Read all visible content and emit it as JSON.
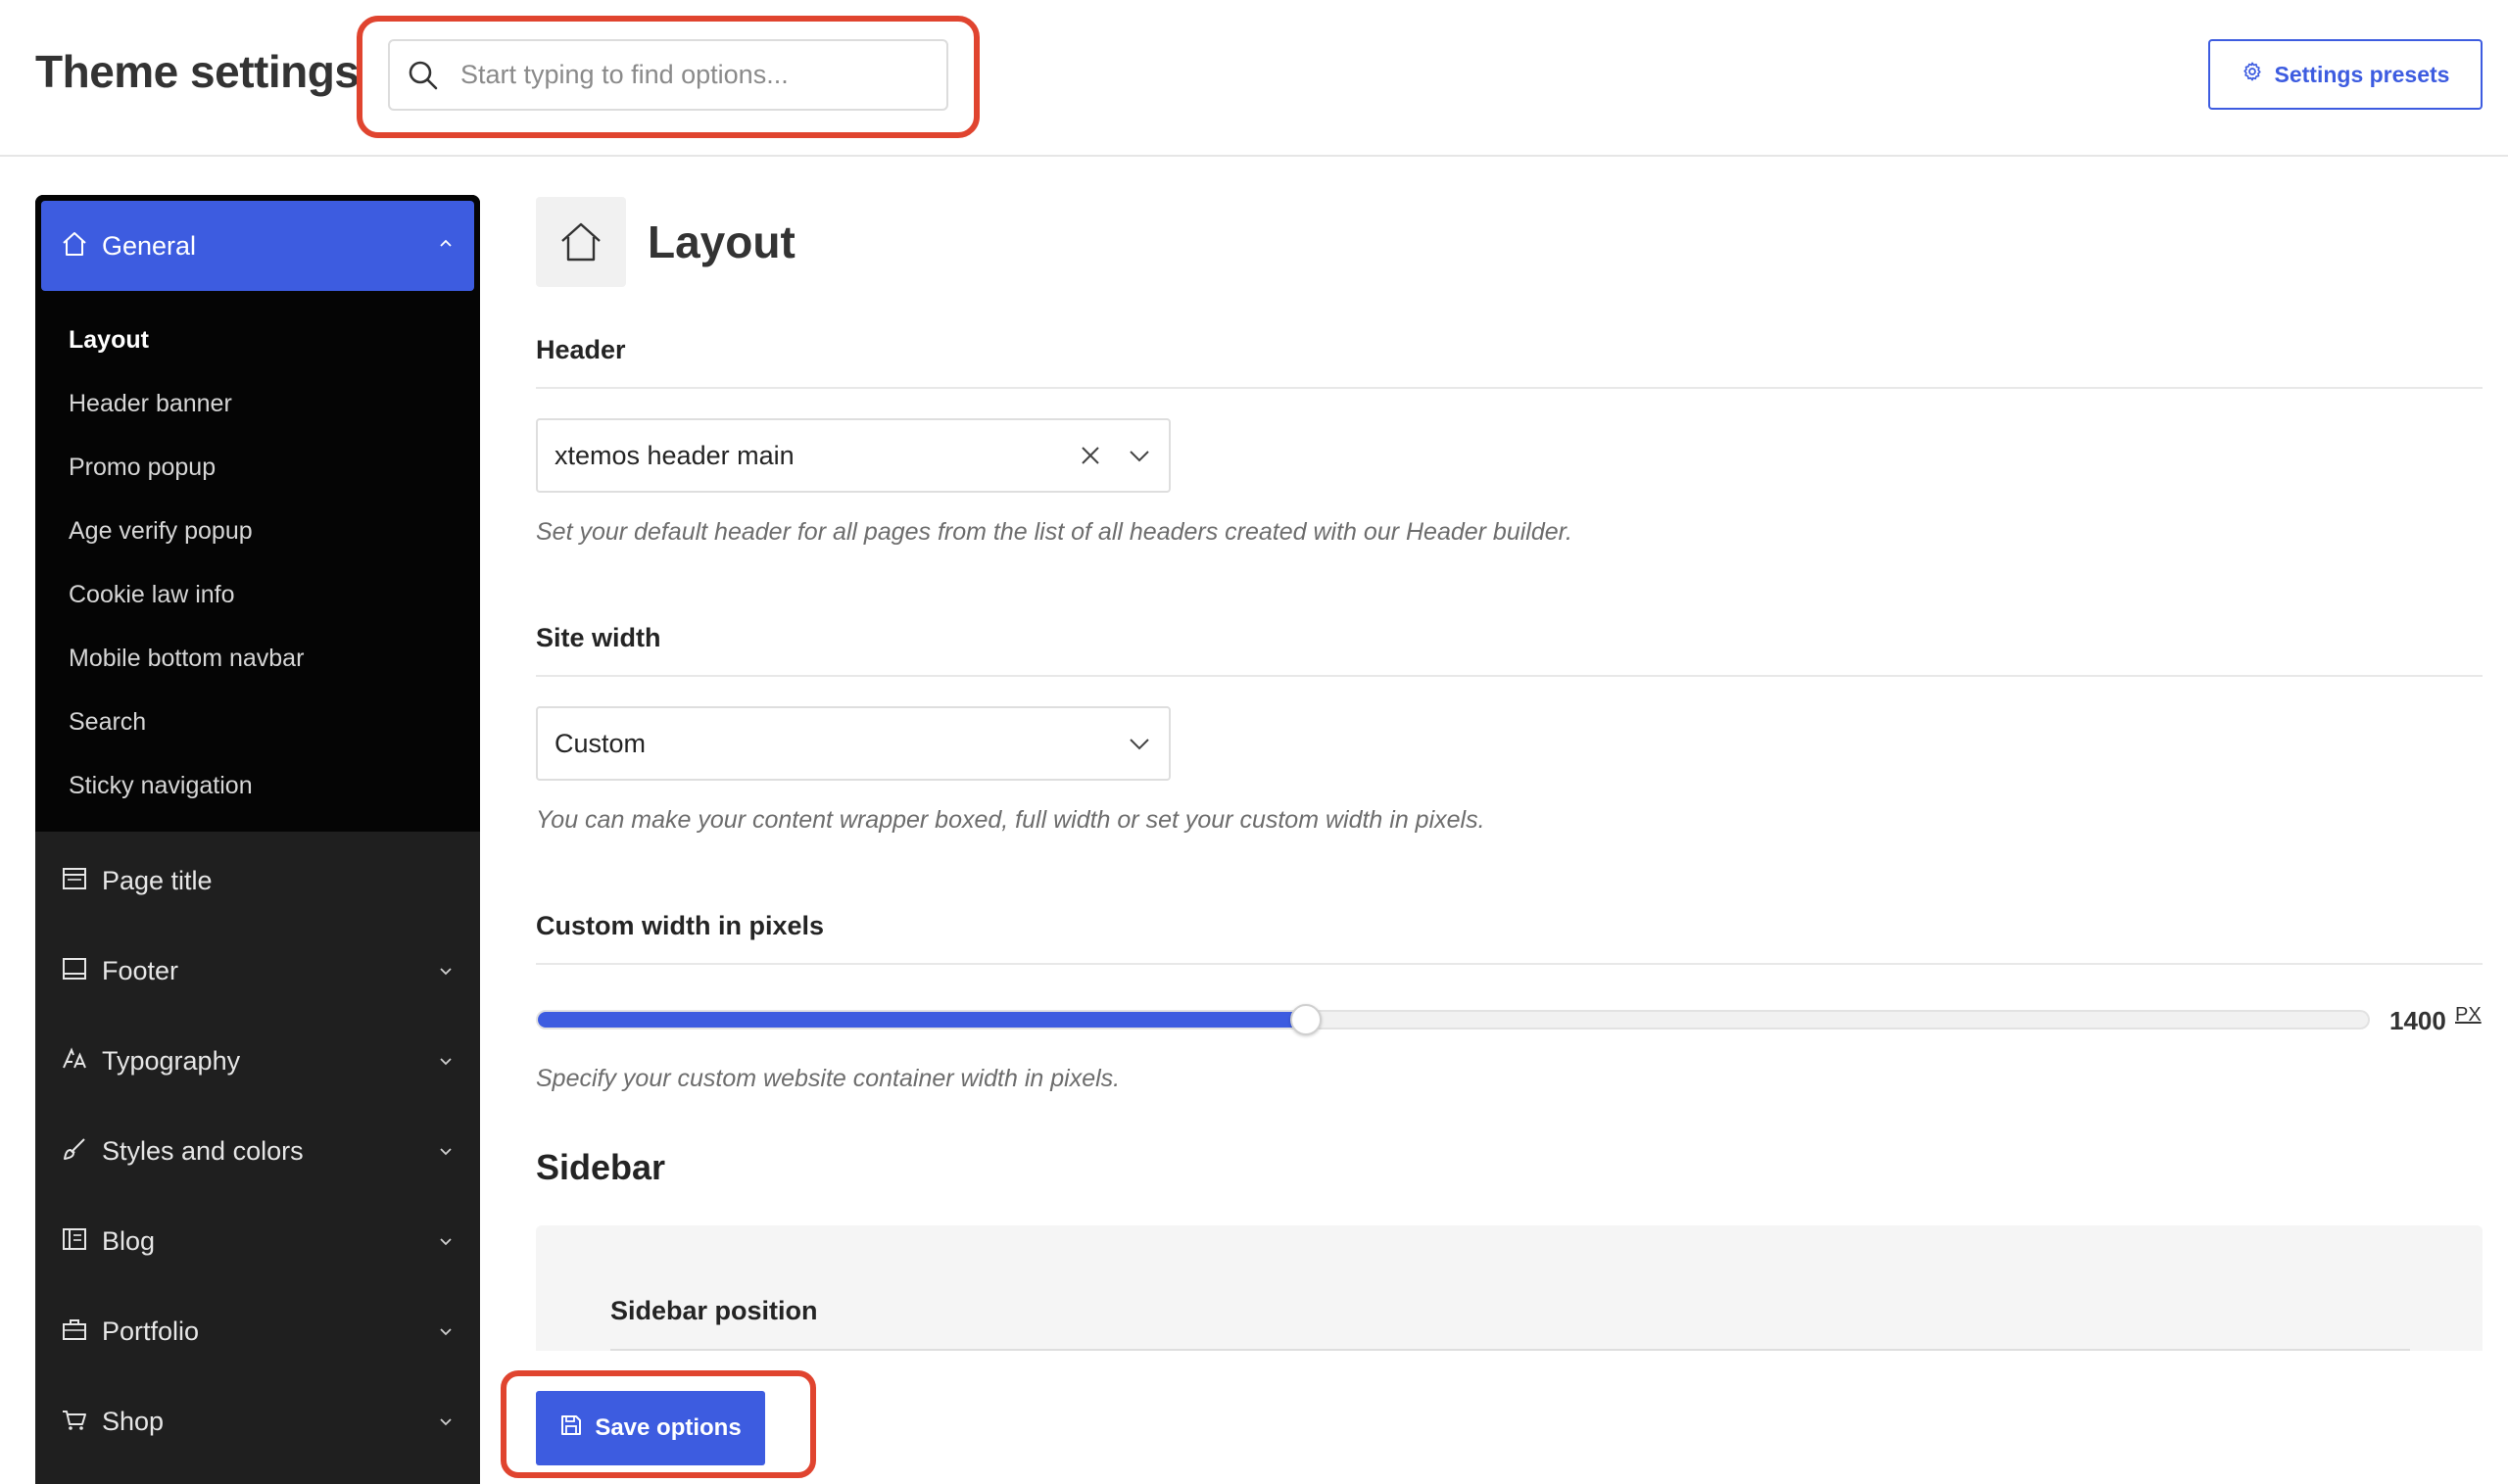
{
  "header": {
    "title": "Theme settings",
    "search_placeholder": "Start typing to find options...",
    "presets_label": "Settings presets"
  },
  "sidebar": {
    "general": {
      "label": "General",
      "items": [
        {
          "label": "Layout",
          "active": true
        },
        {
          "label": "Header banner"
        },
        {
          "label": "Promo popup"
        },
        {
          "label": "Age verify popup"
        },
        {
          "label": "Cookie law info"
        },
        {
          "label": "Mobile bottom navbar"
        },
        {
          "label": "Search"
        },
        {
          "label": "Sticky navigation"
        }
      ]
    },
    "sections": [
      {
        "label": "Page title",
        "icon": "page-title-icon"
      },
      {
        "label": "Footer",
        "icon": "footer-icon"
      },
      {
        "label": "Typography",
        "icon": "typography-icon"
      },
      {
        "label": "Styles and colors",
        "icon": "brush-icon"
      },
      {
        "label": "Blog",
        "icon": "blog-icon"
      },
      {
        "label": "Portfolio",
        "icon": "briefcase-icon"
      },
      {
        "label": "Shop",
        "icon": "cart-icon"
      }
    ]
  },
  "main": {
    "section_title": "Layout",
    "header_field": {
      "label": "Header",
      "value": "xtemos header main",
      "help": "Set your default header for all pages from the list of all headers created with our Header builder."
    },
    "site_width_field": {
      "label": "Site width",
      "value": "Custom",
      "help": "You can make your content wrapper boxed, full width or set your custom width in pixels."
    },
    "custom_width_field": {
      "label": "Custom width in pixels",
      "value": "1400",
      "unit": "PX",
      "fill_fraction": 0.42,
      "help": "Specify your custom website container width in pixels."
    },
    "sidebar_heading": "Sidebar",
    "sidebar_position_label": "Sidebar position"
  },
  "save_label": "Save options",
  "colors": {
    "accent": "#3d5ce0",
    "highlight": "#e0442f",
    "sidebar_bg": "#1f1f1f"
  }
}
